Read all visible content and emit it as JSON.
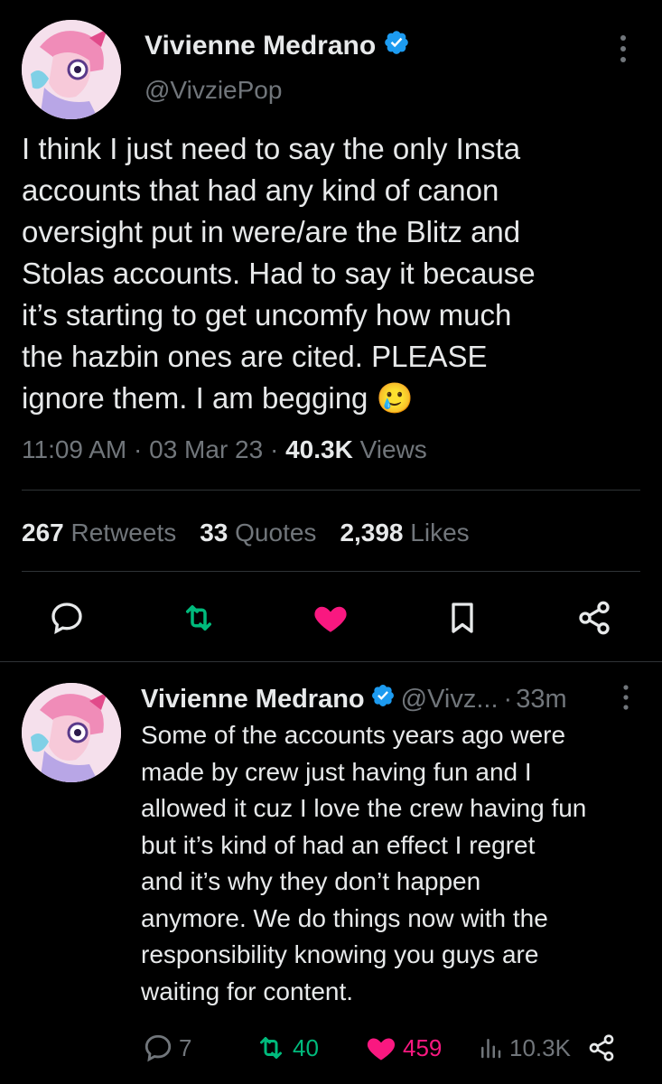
{
  "main_tweet": {
    "author_name": "Vivienne Medrano",
    "handle": "@VivziePop",
    "text_lines": [
      "I think I just need to say the only Insta",
      "accounts that had any kind of canon",
      "oversight put in were/are the Blitz and",
      "Stolas accounts. Had to say it because",
      "it’s starting to get uncomfy how much",
      "the hazbin ones are cited. PLEASE",
      "ignore them. I am begging"
    ],
    "emoji": "🥲",
    "time": "11:09 AM",
    "separator": "·",
    "date": "03 Mar 23",
    "views_count": "40.3K",
    "views_label": "Views",
    "stats": {
      "retweets_count": "267",
      "retweets_label": "Retweets",
      "quotes_count": "33",
      "quotes_label": "Quotes",
      "likes_count": "2,398",
      "likes_label": "Likes"
    }
  },
  "reply_tweet": {
    "author_name": "Vivienne Medrano",
    "handle": "@Vivz...",
    "separator": "·",
    "time_ago": "33m",
    "text_lines": [
      "Some of the accounts years ago were",
      "made by crew just having fun and I",
      "allowed it cuz I love the crew having fun",
      "but it’s kind of had an effect I regret",
      "and it’s why they don’t happen",
      "anymore. We do things now with the",
      "responsibility knowing you guys are",
      "waiting for content."
    ],
    "reply_count": "7",
    "retweet_count": "40",
    "like_count": "459",
    "views_count": "10.3K"
  },
  "colors": {
    "background": "#000000",
    "text": "#e7e9ea",
    "secondary": "#71767b",
    "verified": "#1d9bf0",
    "retweet_active": "#00ba7c",
    "like_active": "#f91880",
    "divider": "#2f3336"
  },
  "icons": {
    "verified": "verified-badge-icon",
    "more": "more-vertical-icon",
    "reply": "reply-icon",
    "retweet": "retweet-icon",
    "like": "heart-icon",
    "bookmark": "bookmark-icon",
    "share": "share-icon",
    "views": "views-chart-icon"
  }
}
